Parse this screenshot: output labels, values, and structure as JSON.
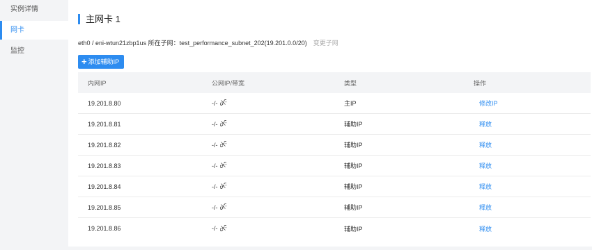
{
  "sidebar": {
    "items": [
      {
        "label": "实例详情",
        "active": false
      },
      {
        "label": "网卡",
        "active": true
      },
      {
        "label": "监控",
        "active": false
      }
    ]
  },
  "section": {
    "title": "主网卡 1"
  },
  "nic": {
    "subnet_text": "eth0 / eni-wtun21zbp1us 所在子网：test_performance_subnet_202(19.201.0.0/20)",
    "change_subnet_label": "变更子网"
  },
  "toolbar": {
    "add_ip_label": "添加辅助IP",
    "add_icon": "plus-icon"
  },
  "table": {
    "headers": [
      "内网IP",
      "公网IP/带宽",
      "类型",
      "操作"
    ],
    "rows": [
      {
        "ip": "19.201.8.80",
        "public": "-/-",
        "type": "主IP",
        "action": "修改IP"
      },
      {
        "ip": "19.201.8.81",
        "public": "-/-",
        "type": "辅助IP",
        "action": "释放"
      },
      {
        "ip": "19.201.8.82",
        "public": "-/-",
        "type": "辅助IP",
        "action": "释放"
      },
      {
        "ip": "19.201.8.83",
        "public": "-/-",
        "type": "辅助IP",
        "action": "释放"
      },
      {
        "ip": "19.201.8.84",
        "public": "-/-",
        "type": "辅助IP",
        "action": "释放"
      },
      {
        "ip": "19.201.8.85",
        "public": "-/-",
        "type": "辅助IP",
        "action": "释放"
      },
      {
        "ip": "19.201.8.86",
        "public": "-/-",
        "type": "辅助IP",
        "action": "释放"
      }
    ],
    "public_icon": "unlink-icon"
  },
  "colors": {
    "accent": "#2d8cf0",
    "sidebar_bg": "#f3f4f6",
    "header_bg": "#f3f4f6"
  }
}
